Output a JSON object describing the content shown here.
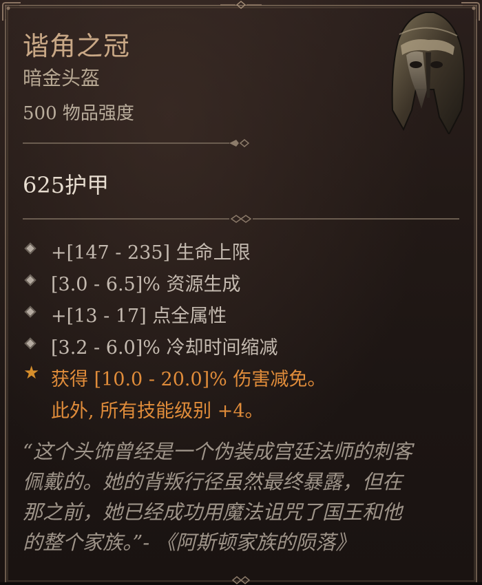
{
  "item": {
    "name": "谐角之冠",
    "type": "暗金头盔",
    "item_power": "500 物品强度",
    "armor": "625护甲",
    "affixes": [
      "+[147 - 235] 生命上限",
      "[3.0 - 6.5]% 资源生成",
      "+[13 - 17] 点全属性",
      "[3.2 - 6.0]% 冷却时间缩减"
    ],
    "legendary": {
      "icon": "star-icon",
      "line1": "获得 [10.0 - 20.0]% 伤害减免。",
      "line2": "此外, 所有技能级别 +4。"
    },
    "flavor": [
      "“这个头饰曾经是一个伪装成宫廷法师的刺客",
      "佩戴的。她的背叛行径虽然最终暴露，但在",
      "那之前，她已经成功用魔法诅咒了国王和他",
      "的整个家族。”- 《阿斯顿家族的陨落》"
    ],
    "image": "helmet-icon"
  },
  "colors": {
    "title": "#c9a886",
    "legendary": "#e08c3a",
    "affix": "#c4bab0",
    "flavor": "#9e9489",
    "frame": "#6b5a4c"
  }
}
